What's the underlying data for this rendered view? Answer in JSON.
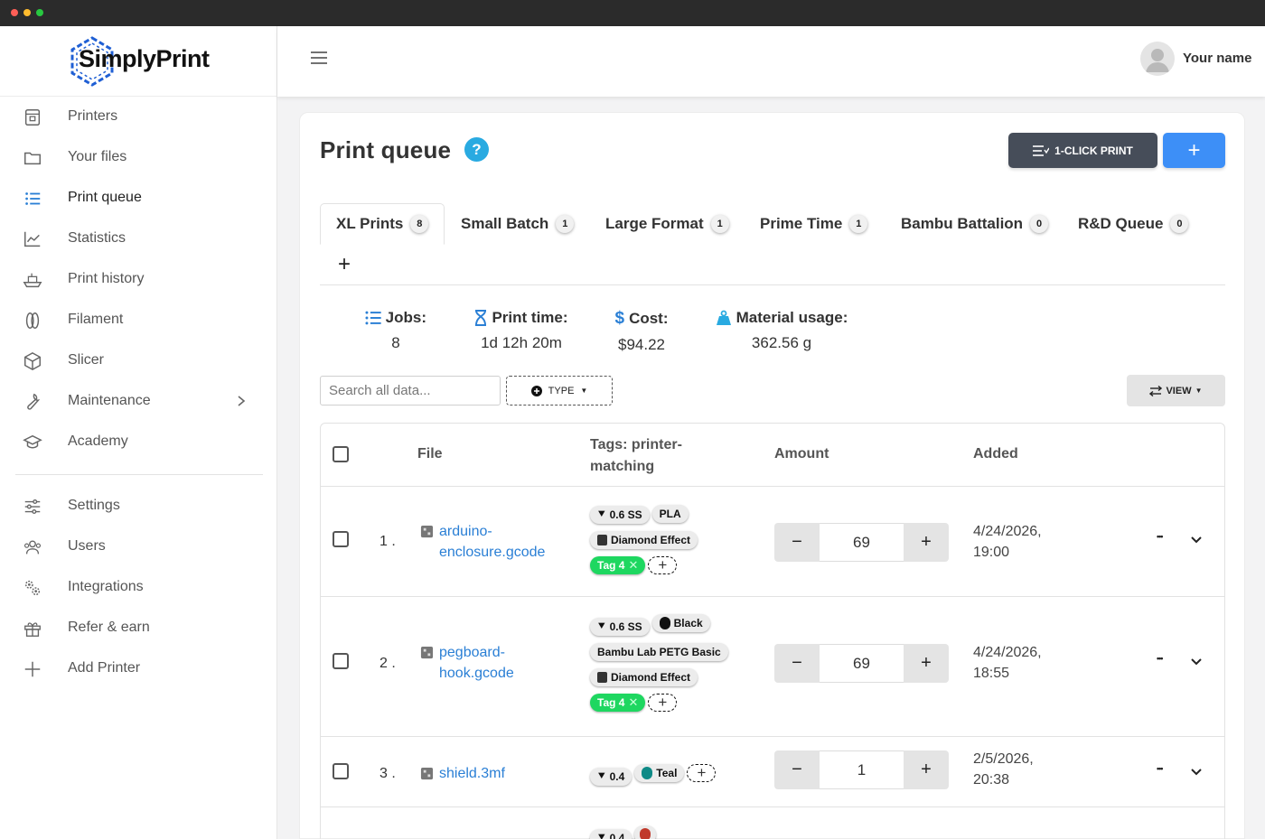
{
  "app": {
    "logo": "SimplyPrint",
    "user": "Your name"
  },
  "sidebar": {
    "items": [
      {
        "label": "Printers",
        "icon": "printer-icon"
      },
      {
        "label": "Your files",
        "icon": "folder-icon"
      },
      {
        "label": "Print queue",
        "icon": "list-icon",
        "active": true
      },
      {
        "label": "Statistics",
        "icon": "chart-icon"
      },
      {
        "label": "Print history",
        "icon": "ship-icon"
      },
      {
        "label": "Filament",
        "icon": "filament-icon"
      },
      {
        "label": "Slicer",
        "icon": "cube-icon"
      },
      {
        "label": "Maintenance",
        "icon": "wrench-icon"
      },
      {
        "label": "Academy",
        "icon": "graduation-cap-icon"
      }
    ],
    "items2": [
      {
        "label": "Settings",
        "icon": "sliders-icon"
      },
      {
        "label": "Users",
        "icon": "users-icon"
      },
      {
        "label": "Integrations",
        "icon": "gears-icon"
      },
      {
        "label": "Refer & earn",
        "icon": "gift-icon"
      },
      {
        "label": "Add Printer",
        "icon": "plus-icon"
      }
    ]
  },
  "page": {
    "title": "Print queue",
    "help": "?",
    "one_click": "1-CLICK PRINT",
    "add": "+"
  },
  "tabs": [
    {
      "label": "XL Prints",
      "count": "8",
      "active": true
    },
    {
      "label": "Small Batch",
      "count": "1"
    },
    {
      "label": "Large Format",
      "count": "1"
    },
    {
      "label": "Prime Time",
      "count": "1"
    },
    {
      "label": "Bambu Battalion",
      "count": "0"
    },
    {
      "label": "R&D Queue",
      "count": "0"
    }
  ],
  "tab_add": "+",
  "stats": {
    "jobs": {
      "label": "Jobs:",
      "value": "8"
    },
    "time": {
      "label": "Print time:",
      "value": "1d 12h 20m"
    },
    "cost": {
      "label": "Cost:",
      "value": "$94.22"
    },
    "material": {
      "label": "Material usage:",
      "value": "362.56 g"
    }
  },
  "filters": {
    "search_placeholder": "Search all data...",
    "type": "TYPE",
    "view": "VIEW"
  },
  "table": {
    "headers": {
      "file": "File",
      "tags": "Tags: printer-matching",
      "amount": "Amount",
      "added": "Added"
    },
    "rows": [
      {
        "idx": "1 .",
        "file": "arduino-enclosure.gcode",
        "amount": "69",
        "added": "4/24/2026, 19:00"
      },
      {
        "idx": "2 .",
        "file": "pegboard-hook.gcode",
        "amount": "69",
        "added": "4/24/2026, 18:55"
      },
      {
        "idx": "3 .",
        "file": "shield.3mf",
        "amount": "1",
        "added": "2/5/2026, 20:38"
      }
    ],
    "tags": {
      "nozzle06": "0.6 SS",
      "pla": "PLA",
      "diamond": "Diamond Effect",
      "tag4": "Tag 4",
      "black": "Black",
      "petg": "Bambu Lab PETG Basic",
      "nozzle04": "0.4",
      "teal": "Teal"
    },
    "minus": "−",
    "plus": "+",
    "more": "•••"
  },
  "colors": {
    "accent": "#2a7fd5",
    "primary_btn": "#3d8ff7",
    "dark_btn": "#464d59",
    "green_tag": "#1ed760",
    "help": "#29aae1"
  }
}
